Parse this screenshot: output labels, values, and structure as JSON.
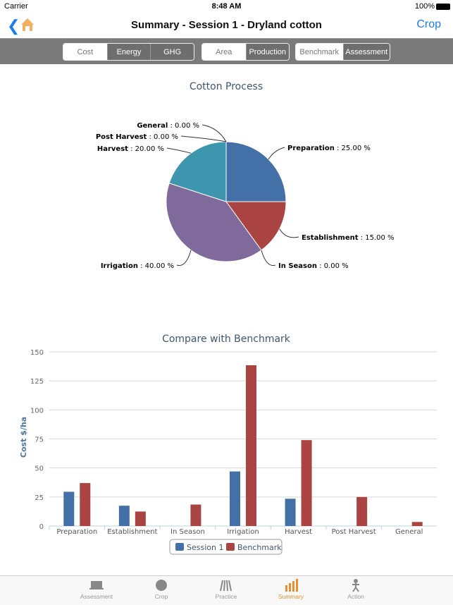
{
  "status": {
    "carrier": "Carrier",
    "time": "8:48 AM",
    "battery": "100%"
  },
  "nav": {
    "title": "Summary - Session 1 - Dryland cotton",
    "right": "Crop"
  },
  "segments": {
    "group1": [
      "Cost",
      "Energy",
      "GHG"
    ],
    "group2": [
      "Area",
      "Production"
    ],
    "group3": [
      "Benchmark",
      "Assessment"
    ],
    "selected": [
      "Cost",
      "Area",
      "Benchmark"
    ]
  },
  "pie_chart": {
    "type": "pie",
    "title": "Cotton Process",
    "slices": [
      {
        "label": "Preparation",
        "value": 25.0,
        "color": "#4470a8"
      },
      {
        "label": "Establishment",
        "value": 15.0,
        "color": "#aa4443"
      },
      {
        "label": "In Season",
        "value": 0.0,
        "color": "#89a54e"
      },
      {
        "label": "Irrigation",
        "value": 40.0,
        "color": "#80699b"
      },
      {
        "label": "Harvest",
        "value": 20.0,
        "color": "#3d96ae"
      },
      {
        "label": "Post Harvest",
        "value": 0.0,
        "color": "#db843d"
      },
      {
        "label": "General",
        "value": 0.0,
        "color": "#92a8cd"
      }
    ],
    "unit": "%"
  },
  "chart_data": {
    "type": "bar",
    "title": "Compare with Benchmark",
    "categories": [
      "Preparation",
      "Establishment",
      "In Season",
      "Irrigation",
      "Harvest",
      "Post Harvest",
      "General"
    ],
    "series": [
      {
        "name": "Session 1",
        "color": "#4470a8",
        "values": [
          29.5,
          17.5,
          0,
          47,
          23.5,
          0,
          0
        ]
      },
      {
        "name": "Benchmark",
        "color": "#aa4443",
        "values": [
          37,
          12.5,
          18.5,
          138.5,
          74,
          25,
          3.5
        ]
      }
    ],
    "ylabel": "Cost $/ha",
    "ylim": [
      0,
      150
    ],
    "yticks": [
      0,
      25,
      50,
      75,
      100,
      125,
      150
    ],
    "grid": true,
    "legend": "bottom"
  },
  "tabs": [
    {
      "label": "Assessment",
      "active": false
    },
    {
      "label": "Crop",
      "active": false
    },
    {
      "label": "Practice",
      "active": false
    },
    {
      "label": "Summary",
      "active": true
    },
    {
      "label": "Action",
      "active": false
    }
  ],
  "colors": {
    "accent": "#1a7cf5",
    "active_tab": "#e8902f"
  }
}
